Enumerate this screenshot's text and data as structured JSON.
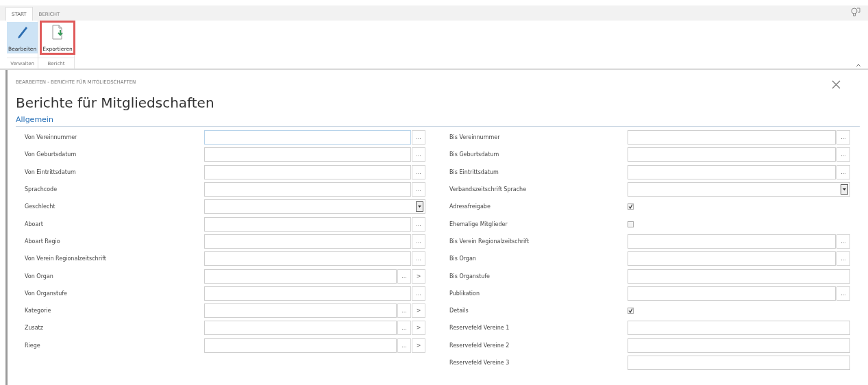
{
  "ribbon": {
    "tabs": [
      {
        "label": "START",
        "selected": true
      },
      {
        "label": "BERICHT",
        "selected": false
      }
    ],
    "groups": [
      {
        "label": "Verwalten",
        "buttons": [
          {
            "label": "Bearbeiten",
            "kind": "edit",
            "selected": true,
            "highlighted": false
          }
        ]
      },
      {
        "label": "Bericht",
        "buttons": [
          {
            "label": "Exportieren",
            "kind": "export",
            "selected": false,
            "highlighted": true
          }
        ]
      }
    ]
  },
  "breadcrumb": "BEARBEITEN - BERICHTE FÜR MITGLIEDSCHAFTEN",
  "title": "Berichte für Mitgliedschaften",
  "section": "Allgemein",
  "left_fields": [
    {
      "label": "Von Vereinnummer",
      "kind": "lookup",
      "buttons": [
        "..."
      ],
      "focused": true
    },
    {
      "label": "Von Geburtsdatum",
      "kind": "lookup",
      "buttons": [
        "..."
      ]
    },
    {
      "label": "Von Eintrittsdatum",
      "kind": "lookup",
      "buttons": [
        "..."
      ]
    },
    {
      "label": "Sprachcode",
      "kind": "lookup",
      "buttons": [
        "..."
      ]
    },
    {
      "label": "Geschlecht",
      "kind": "select"
    },
    {
      "label": "Aboart",
      "kind": "lookup",
      "buttons": [
        "..."
      ]
    },
    {
      "label": "Aboart Regio",
      "kind": "lookup",
      "buttons": [
        "..."
      ]
    },
    {
      "label": "Von Verein Regionalzeitschrift",
      "kind": "lookup",
      "buttons": [
        "..."
      ]
    },
    {
      "label": "Von Organ",
      "kind": "lookup",
      "buttons": [
        "...",
        ">"
      ]
    },
    {
      "label": "Von Organstufe",
      "kind": "lookup",
      "buttons": [
        "..."
      ]
    },
    {
      "label": "Kategorie",
      "kind": "lookup",
      "buttons": [
        "...",
        ">"
      ]
    },
    {
      "label": "Zusatz",
      "kind": "lookup",
      "buttons": [
        "...",
        ">"
      ]
    },
    {
      "label": "Riege",
      "kind": "lookup",
      "buttons": [
        "...",
        ">"
      ]
    }
  ],
  "right_fields": [
    {
      "label": "Bis Vereinnummer",
      "kind": "lookup",
      "buttons": [
        "..."
      ]
    },
    {
      "label": "Bis Geburtsdatum",
      "kind": "lookup",
      "buttons": [
        "..."
      ]
    },
    {
      "label": "Bis Eintrittsdatum",
      "kind": "lookup",
      "buttons": [
        "..."
      ]
    },
    {
      "label": "Verbandszeitschrift Sprache",
      "kind": "select"
    },
    {
      "label": "Adressfreigabe",
      "kind": "checkbox",
      "checked": true
    },
    {
      "label": "Ehemalige Mitglieder",
      "kind": "checkbox",
      "checked": false
    },
    {
      "label": "Bis Verein Regionalzeitschrift",
      "kind": "lookup",
      "buttons": [
        "..."
      ]
    },
    {
      "label": "Bis Organ",
      "kind": "lookup",
      "buttons": [
        "..."
      ]
    },
    {
      "label": "Bis Organstufe",
      "kind": "text"
    },
    {
      "label": "Publikation",
      "kind": "lookup",
      "buttons": [
        "..."
      ]
    },
    {
      "label": "Details",
      "kind": "checkbox",
      "checked": true
    },
    {
      "label": "Reservefeld Vereine 1",
      "kind": "text"
    },
    {
      "label": "Reservefeld Vereine 2",
      "kind": "text"
    },
    {
      "label": "Reservefeld Vereine 3",
      "kind": "text"
    }
  ]
}
